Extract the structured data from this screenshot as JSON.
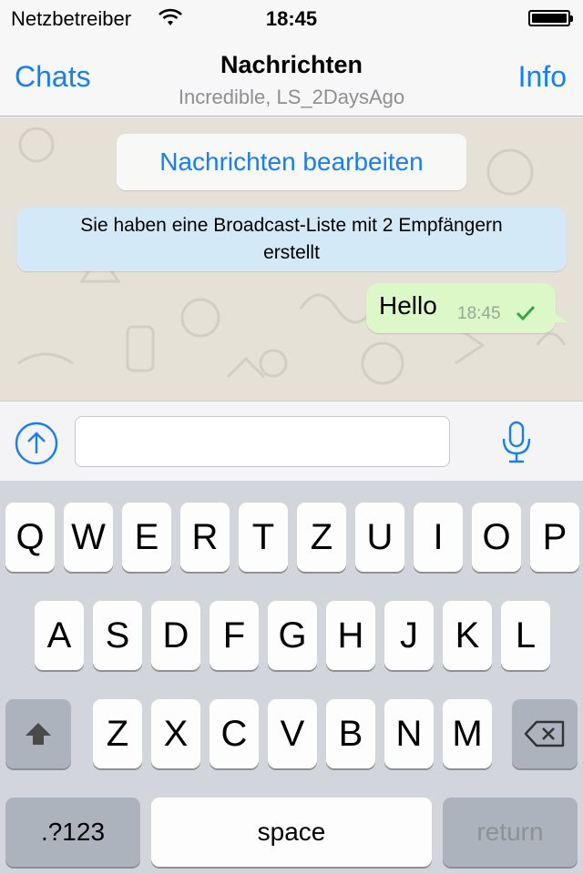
{
  "status_bar": {
    "carrier": "Netzbetreiber",
    "time": "18:45",
    "battery_level": 1.0
  },
  "nav": {
    "back_label": "Chats",
    "title": "Nachrichten",
    "subtitle": "Incredible, LS_2DaysAgo",
    "info_label": "Info"
  },
  "chat": {
    "edit_label": "Nachrichten bearbeiten",
    "system_line1": "Sie haben eine Broadcast-Liste mit 2 Empfängern",
    "system_line2": "erstellt",
    "message": {
      "text": "Hello",
      "time": "18:45",
      "status_icon": "checkmark-icon"
    }
  },
  "input": {
    "value": "",
    "placeholder": ""
  },
  "keyboard": {
    "row1": [
      "Q",
      "W",
      "E",
      "R",
      "T",
      "Z",
      "U",
      "I",
      "O",
      "P"
    ],
    "row2": [
      "A",
      "S",
      "D",
      "F",
      "G",
      "H",
      "J",
      "K",
      "L"
    ],
    "row3": [
      "Z",
      "X",
      "C",
      "V",
      "B",
      "N",
      "M"
    ],
    "numbers_label": ".?123",
    "space_label": "space",
    "return_label": "return"
  },
  "colors": {
    "accent": "#157efb",
    "outgoing_bubble": "#dcf8c6",
    "system_bubble": "#d4e9f7",
    "chat_background": "#e6e1d7",
    "keyboard_bg": "#d2d5db"
  }
}
